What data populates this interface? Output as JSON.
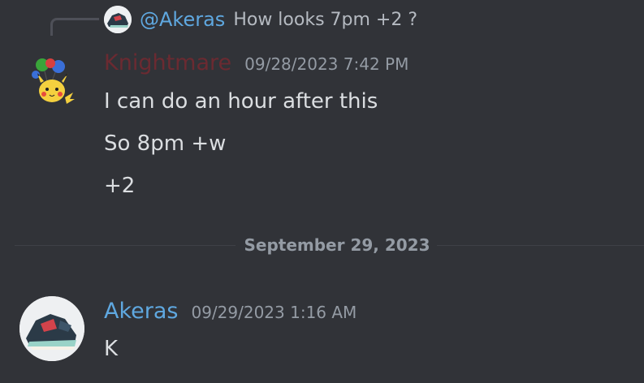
{
  "reply": {
    "mention": "@Akeras",
    "text": "How looks 7pm +2 ?"
  },
  "message1": {
    "username": "Knightmare",
    "timestamp": "09/28/2023 7:42 PM",
    "lines": [
      "I can do an hour after this",
      "So 8pm +w",
      "+2"
    ]
  },
  "divider": {
    "label": "September 29, 2023"
  },
  "message2": {
    "username": "Akeras",
    "timestamp": "09/29/2023 1:16 AM",
    "lines": [
      "K"
    ]
  },
  "colors": {
    "background": "#313338",
    "knightmare_name": "#6b2a31",
    "akeras_name": "#5fa8e0",
    "timestamp": "#949ba4",
    "divider": "#3f4147"
  },
  "icons": {
    "reply_avatar": "sneaker-avatar-icon",
    "message1_avatar": "pikachu-balloons-avatar-icon",
    "message2_avatar": "sneaker-avatar-icon"
  }
}
